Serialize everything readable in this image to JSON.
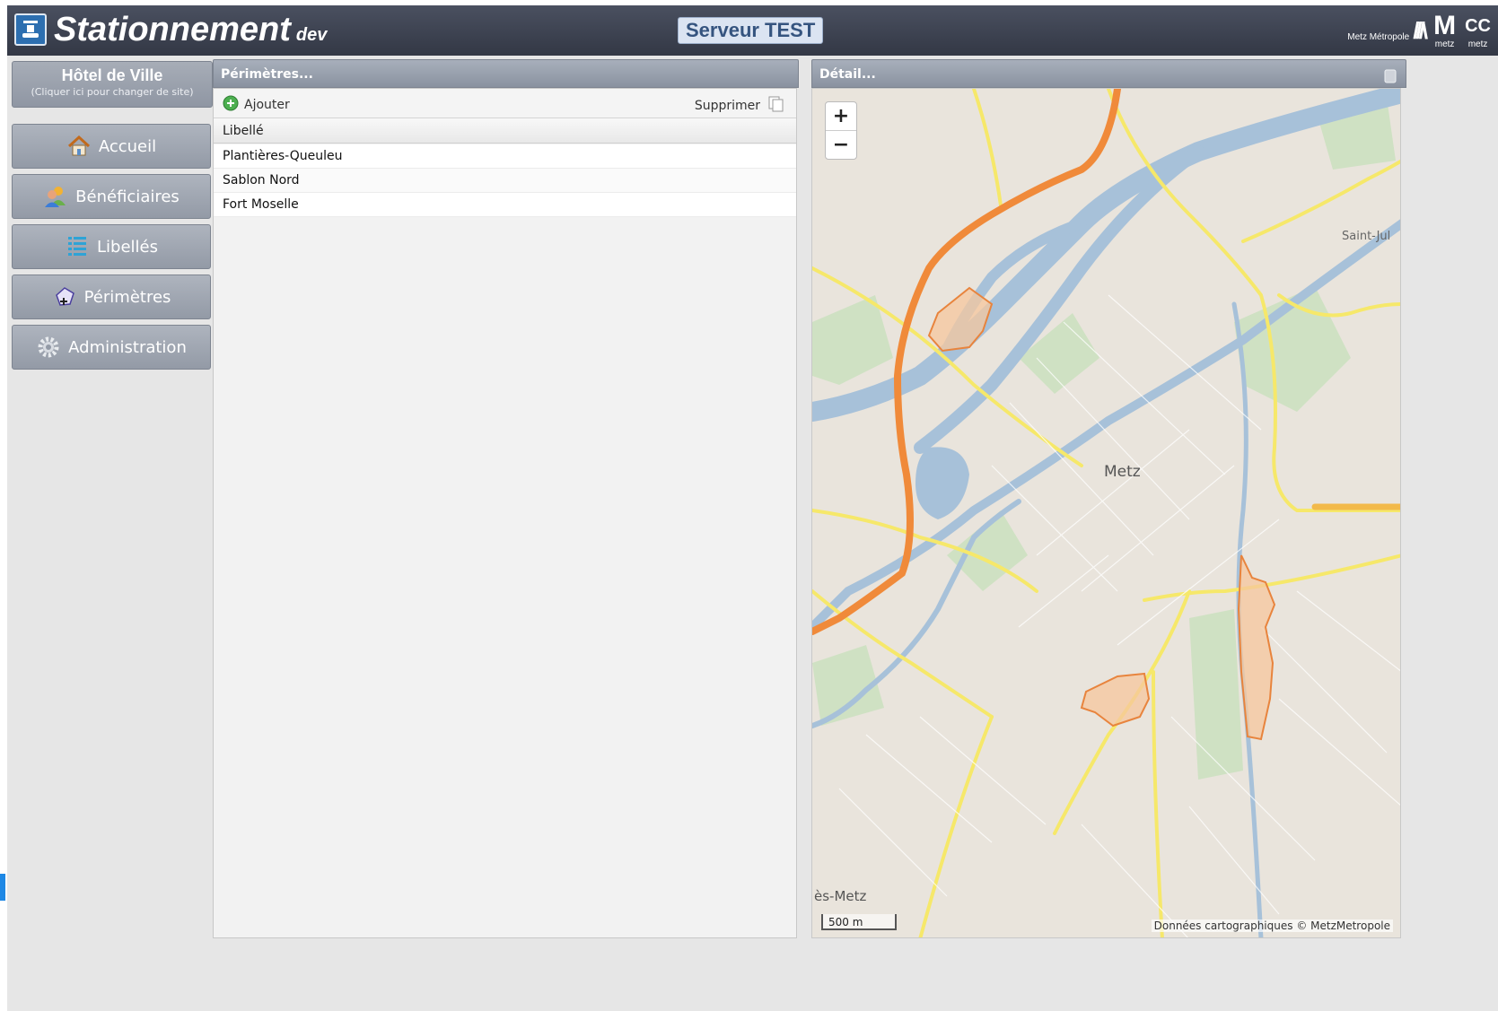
{
  "header": {
    "title": "Stationnement",
    "env": "dev",
    "server_badge": "Serveur TEST",
    "logo_metropole": "Metz Métropole",
    "logo_metz": "metz",
    "logo_ccas": "metz"
  },
  "sidebar": {
    "site_name": "Hôtel de Ville",
    "site_hint": "(Cliquer ici pour changer de site)",
    "items": [
      {
        "label": "Accueil",
        "icon": "home-icon"
      },
      {
        "label": "Bénéficiaires",
        "icon": "users-icon"
      },
      {
        "label": "Libellés",
        "icon": "list-icon"
      },
      {
        "label": "Périmètres",
        "icon": "polygon-add-icon"
      },
      {
        "label": "Administration",
        "icon": "gear-icon"
      }
    ]
  },
  "perimetres": {
    "title": "Périmètres...",
    "add_label": "Ajouter",
    "delete_label": "Supprimer",
    "column": "Libellé",
    "rows": [
      "Plantières-Queuleu",
      "Sablon Nord",
      "Fort Moselle"
    ]
  },
  "detail": {
    "title": "Détail...",
    "map": {
      "city_label": "Metz",
      "label_ne": "Saint-Jul",
      "label_sw": "ès-Metz",
      "scale": "500 m",
      "attribution": "Données cartographiques © MetzMetropole",
      "zoom_in": "+",
      "zoom_out": "−"
    }
  },
  "colors": {
    "header": "#3d4250",
    "accent": "#2d6fb0",
    "water": "#a7c1d9",
    "road_main": "#f08a3a",
    "road_yellow": "#f6e86a",
    "perimeter_fill": "#f6c79e",
    "perimeter_stroke": "#e8843d"
  }
}
